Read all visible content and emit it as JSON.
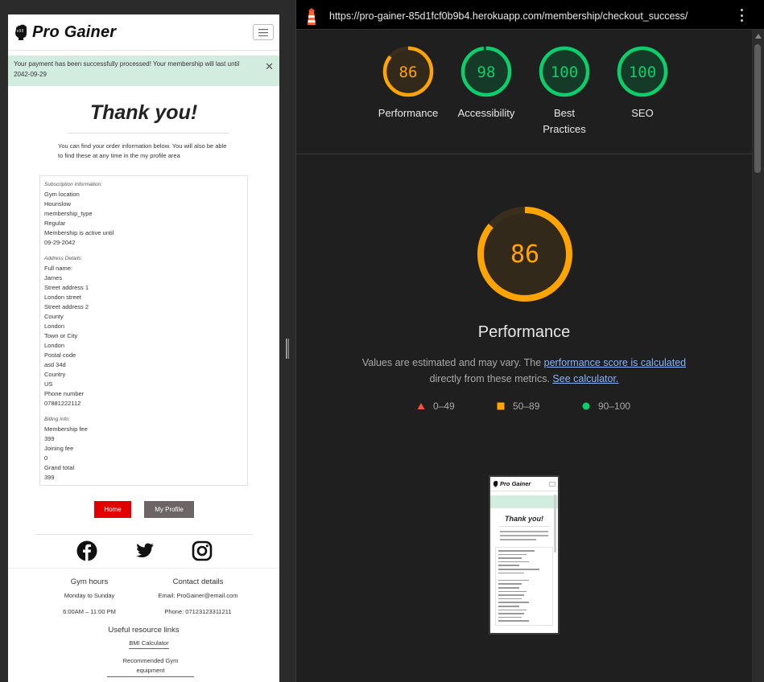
{
  "left": {
    "brand": "Pro Gainer",
    "alert_text": "Your payment has been successfully processed! Your membership will last until 2042-09-29",
    "alert_close": "✕",
    "heading": "Thank you!",
    "intro": "You can find your order information below. You will also be able to find these at any time in the my profile area",
    "subscription": {
      "heading": "Subscription Information:",
      "lines": [
        "Gym location",
        "Hounslow",
        "membership_type",
        "Regular",
        "Membership is active until",
        "09-29-2042"
      ]
    },
    "address": {
      "heading": "Address Details:",
      "lines": [
        "Full name:",
        "James",
        "Street address 1",
        "London street",
        "Street address 2",
        "County",
        "London",
        "Town or City",
        "London",
        "Postal code",
        "asd 34d",
        "Country",
        "US",
        "Phone number",
        "07881222112"
      ]
    },
    "billing": {
      "heading": "Billing Info:",
      "lines": [
        "Membership fee",
        "399",
        "Joining fee",
        "0",
        "Grand total",
        "399"
      ]
    },
    "buttons": {
      "home": "Home",
      "profile": "My Profile"
    },
    "footer": {
      "hours_title": "Gym hours",
      "hours_days": "Monday to Sunday",
      "hours_time": "6:00AM – 11:00 PM",
      "contact_title": "Contact details",
      "contact_email": "Email: ProGainer@email.com",
      "contact_phone": "Phone: 07123123311211",
      "links_title": "Useful resource links",
      "link_bmi": "BMI Calculator",
      "link_equipment_1": "Recommended Gym",
      "link_equipment_2": "equipment"
    }
  },
  "right": {
    "url": "https://pro-gainer-85d1fcf0b9b4.herokuapp.com/membership/checkout_success/",
    "scores": [
      {
        "value": "86",
        "label": "Performance",
        "color": "#ffa400",
        "fraction": 0.86
      },
      {
        "value": "98",
        "label": "Accessibility",
        "color": "#0cce6b",
        "fraction": 0.98
      },
      {
        "value": "100",
        "label": "Best Practices",
        "color": "#0cce6b",
        "fraction": 1.0
      },
      {
        "value": "100",
        "label": "SEO",
        "color": "#0cce6b",
        "fraction": 1.0
      }
    ],
    "big_gauge": {
      "value": "86",
      "fraction": 0.86,
      "color": "#ffa400"
    },
    "title": "Performance",
    "desc_prefix": "Values are estimated and may vary. The ",
    "desc_link1": "performance score is calculated",
    "desc_middle": "directly from these metrics. ",
    "desc_link2": "See calculator.",
    "legend": [
      {
        "range": "0–49",
        "color": "#ff4e42"
      },
      {
        "range": "50–89",
        "color": "#ffa400"
      },
      {
        "range": "90–100",
        "color": "#0cce6b"
      }
    ],
    "thumbnail": {
      "brand": "Pro Gainer",
      "heading": "Thank you!"
    }
  }
}
